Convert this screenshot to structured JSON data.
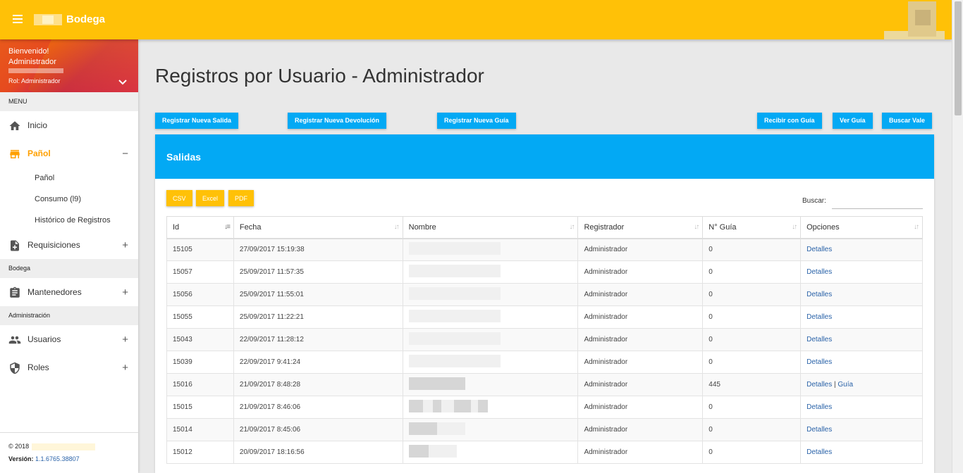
{
  "topbar": {
    "app_name": "Bodega",
    "menu_icon": "hamburger-icon"
  },
  "user": {
    "welcome": "Bienvenido!",
    "name": "Administrador",
    "role": "Rol: Administrador"
  },
  "sidebar": {
    "menu_label": "MENU",
    "items": [
      {
        "label": "Inicio",
        "icon": "home-icon"
      },
      {
        "label": "Pañol",
        "icon": "store-icon",
        "toggle": "−"
      },
      {
        "label": "Requisiciones",
        "icon": "add-file-icon",
        "toggle": "+"
      }
    ],
    "sub_items": [
      "Pañol",
      "Consumo (l9)",
      "Histórico de Registros"
    ],
    "bodega_label": "Bodega",
    "mantenedores": {
      "label": "Mantenedores",
      "icon": "clipboard-icon",
      "toggle": "+"
    },
    "admin_label": "Administración",
    "usuarios": {
      "label": "Usuarios",
      "icon": "users-icon",
      "toggle": "+"
    },
    "roles": {
      "label": "Roles",
      "icon": "shield-icon",
      "toggle": "+"
    },
    "footer": {
      "copyright": "© 2018",
      "version_label": "Versión:",
      "version": "1.1.6765.38807"
    }
  },
  "main": {
    "title": "Registros por Usuario - Administrador",
    "buttons": {
      "nueva_salida": "Registrar Nueva Salida",
      "nueva_devolucion": "Registrar Nueva Devolución",
      "nueva_guia": "Registrar Nueva Guía",
      "recibir_guia": "Recibir con Guía",
      "ver_guia": "Ver Guía",
      "buscar_vale": "Buscar Vale"
    },
    "card_title": "Salidas",
    "export": {
      "csv": "CSV",
      "excel": "Excel",
      "pdf": "PDF"
    },
    "search_label": "Buscar:",
    "search_value": "",
    "columns": [
      "Id",
      "Fecha",
      "Nombre",
      "Registrador",
      "N° Guía",
      "Opciones"
    ],
    "rows": [
      {
        "id": "15105",
        "fecha": "27/09/2017 15:19:38",
        "registrador": "Administrador",
        "guia": "0",
        "opcion": "Detalles",
        "extra": ""
      },
      {
        "id": "15057",
        "fecha": "25/09/2017 11:57:35",
        "registrador": "Administrador",
        "guia": "0",
        "opcion": "Detalles",
        "extra": ""
      },
      {
        "id": "15056",
        "fecha": "25/09/2017 11:55:01",
        "registrador": "Administrador",
        "guia": "0",
        "opcion": "Detalles",
        "extra": ""
      },
      {
        "id": "15055",
        "fecha": "25/09/2017 11:22:21",
        "registrador": "Administrador",
        "guia": "0",
        "opcion": "Detalles",
        "extra": ""
      },
      {
        "id": "15043",
        "fecha": "22/09/2017 11:28:12",
        "registrador": "Administrador",
        "guia": "0",
        "opcion": "Detalles",
        "extra": ""
      },
      {
        "id": "15039",
        "fecha": "22/09/2017 9:41:24",
        "registrador": "Administrador",
        "guia": "0",
        "opcion": "Detalles",
        "extra": ""
      },
      {
        "id": "15016",
        "fecha": "21/09/2017 8:48:28",
        "registrador": "Administrador",
        "guia": "445",
        "opcion": "Detalles",
        "extra": "Guía"
      },
      {
        "id": "15015",
        "fecha": "21/09/2017 8:46:06",
        "registrador": "Administrador",
        "guia": "0",
        "opcion": "Detalles",
        "extra": ""
      },
      {
        "id": "15014",
        "fecha": "21/09/2017 8:45:06",
        "registrador": "Administrador",
        "guia": "0",
        "opcion": "Detalles",
        "extra": ""
      },
      {
        "id": "15012",
        "fecha": "20/09/2017 18:16:56",
        "registrador": "Administrador",
        "guia": "0",
        "opcion": "Detalles",
        "extra": ""
      }
    ]
  },
  "colors": {
    "topbar": "#ffc107",
    "accent_blue": "#03a9f4",
    "active_nav": "#ffa000",
    "link": "#2962a8"
  }
}
